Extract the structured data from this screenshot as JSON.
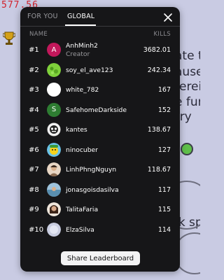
{
  "background": {
    "score_text": "577.56",
    "snippets": [
      "ate th",
      "ause",
      "ferei",
      "e fur",
      "rry",
      "lk sp"
    ]
  },
  "tabs": [
    {
      "label": "FOR YOU",
      "active": false
    },
    {
      "label": "GLOBAL",
      "active": true
    }
  ],
  "close_icon": "close-icon",
  "columns": {
    "name": "NAME",
    "kills": "KILLS"
  },
  "leaderboard": [
    {
      "rank": "#1",
      "name": "AnhMinh2",
      "subtitle": "Creator",
      "kills": "3682.01",
      "avatar_letter": "A",
      "avatar_color": "#c2185b"
    },
    {
      "rank": "#2",
      "name": "soy_el_ave123",
      "subtitle": "",
      "kills": "242.34",
      "avatar_letter": "",
      "avatar_color": "#7fd13b"
    },
    {
      "rank": "#3",
      "name": "white_782",
      "subtitle": "",
      "kills": "167",
      "avatar_letter": "",
      "avatar_color": "#ffffff"
    },
    {
      "rank": "#4",
      "name": "SafehomeDarkside",
      "subtitle": "",
      "kills": "152",
      "avatar_letter": "S",
      "avatar_color": "#2e7d32"
    },
    {
      "rank": "#5",
      "name": "kantes",
      "subtitle": "",
      "kills": "138.67",
      "avatar_letter": "",
      "avatar_color": "#222222"
    },
    {
      "rank": "#6",
      "name": "ninocuber",
      "subtitle": "",
      "kills": "127",
      "avatar_letter": "",
      "avatar_color": "#6ac3e8"
    },
    {
      "rank": "#7",
      "name": "LinhPhngNguyn",
      "subtitle": "",
      "kills": "118.67",
      "avatar_letter": "",
      "avatar_color": "#d9b08c"
    },
    {
      "rank": "#8",
      "name": "jonasgoisdasilva",
      "subtitle": "",
      "kills": "117",
      "avatar_letter": "",
      "avatar_color": "#5a8fb0"
    },
    {
      "rank": "#9",
      "name": "TalitaFaria",
      "subtitle": "",
      "kills": "115",
      "avatar_letter": "",
      "avatar_color": "#a0785a"
    },
    {
      "rank": "#10",
      "name": "ElzaSilva",
      "subtitle": "",
      "kills": "114",
      "avatar_letter": "",
      "avatar_color": "#c9cde0"
    }
  ],
  "share_button": "Share Leaderboard"
}
